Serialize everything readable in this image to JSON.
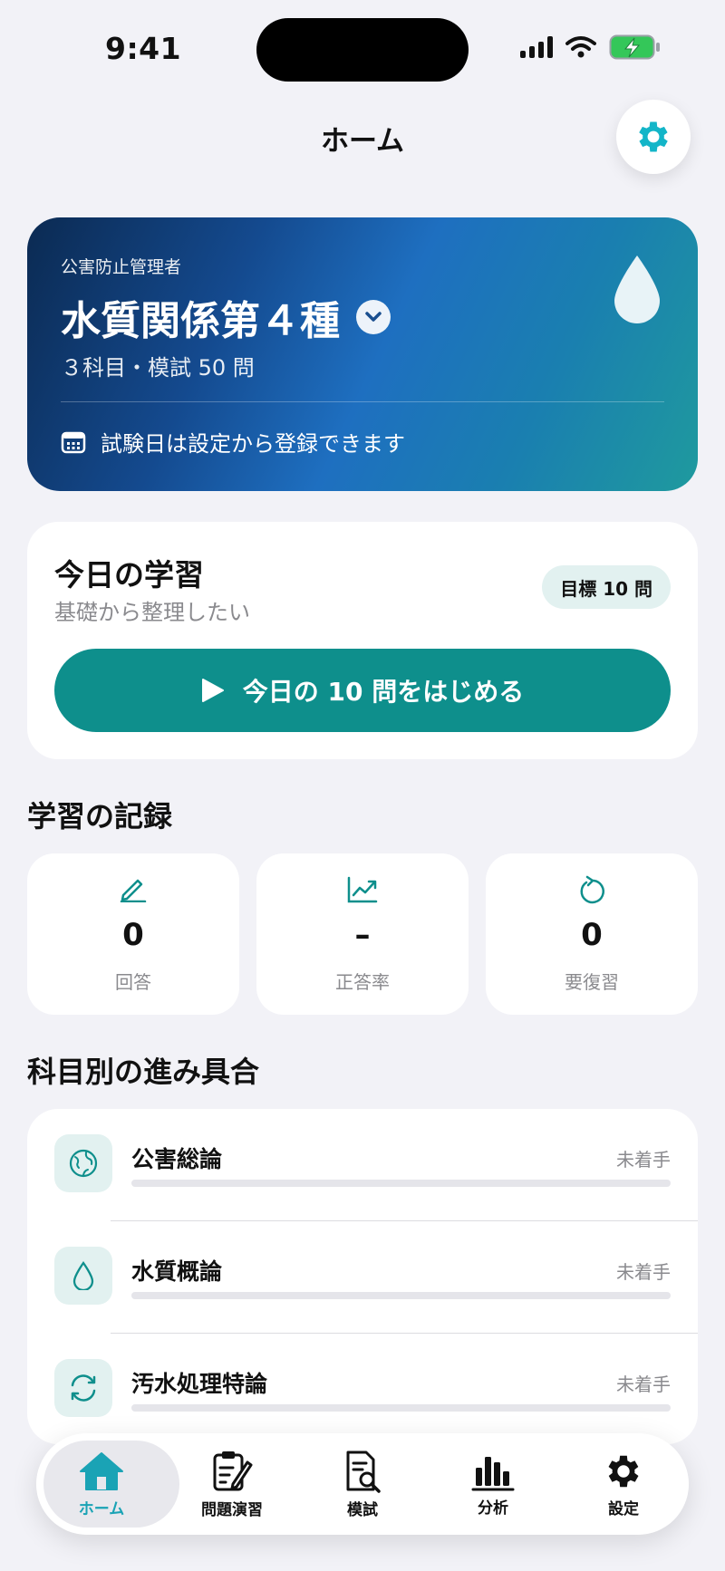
{
  "status": {
    "time": "9:41"
  },
  "nav": {
    "title": "ホーム",
    "settings_icon": "gear-icon"
  },
  "hero": {
    "category": "公害防止管理者",
    "title": "水質関係第４種",
    "meta": "３科目・模試 50 問",
    "footer": "試験日は設定から登録できます"
  },
  "today": {
    "title": "今日の学習",
    "subtitle": "基礎から整理したい",
    "goal": "目標 10 問",
    "start_button": "今日の 10 問をはじめる"
  },
  "records": {
    "title": "学習の記録",
    "stats": [
      {
        "icon": "pencil-icon",
        "value": "0",
        "label": "回答"
      },
      {
        "icon": "trend-chart-icon",
        "value": "–",
        "label": "正答率"
      },
      {
        "icon": "redo-icon",
        "value": "0",
        "label": "要復習"
      }
    ]
  },
  "subjects": {
    "title": "科目別の進み具合",
    "items": [
      {
        "icon": "globe-icon",
        "name": "公害総論",
        "status": "未着手",
        "progress": 0
      },
      {
        "icon": "drop-icon",
        "name": "水質概論",
        "status": "未着手",
        "progress": 0
      },
      {
        "icon": "cycle-icon",
        "name": "汚水処理特論",
        "status": "未着手",
        "progress": 0
      }
    ]
  },
  "tabbar": {
    "tabs": [
      {
        "icon": "home-icon",
        "label": "ホーム",
        "active": true
      },
      {
        "icon": "clipboard-icon",
        "label": "問題演習"
      },
      {
        "icon": "document-search-icon",
        "label": "模試"
      },
      {
        "icon": "bar-chart-icon",
        "label": "分析"
      },
      {
        "icon": "gear-icon",
        "label": "設定"
      }
    ]
  },
  "colors": {
    "accent": "#0e8f8c",
    "tab_active": "#1aa3b5",
    "gear": "#13b5c8"
  }
}
